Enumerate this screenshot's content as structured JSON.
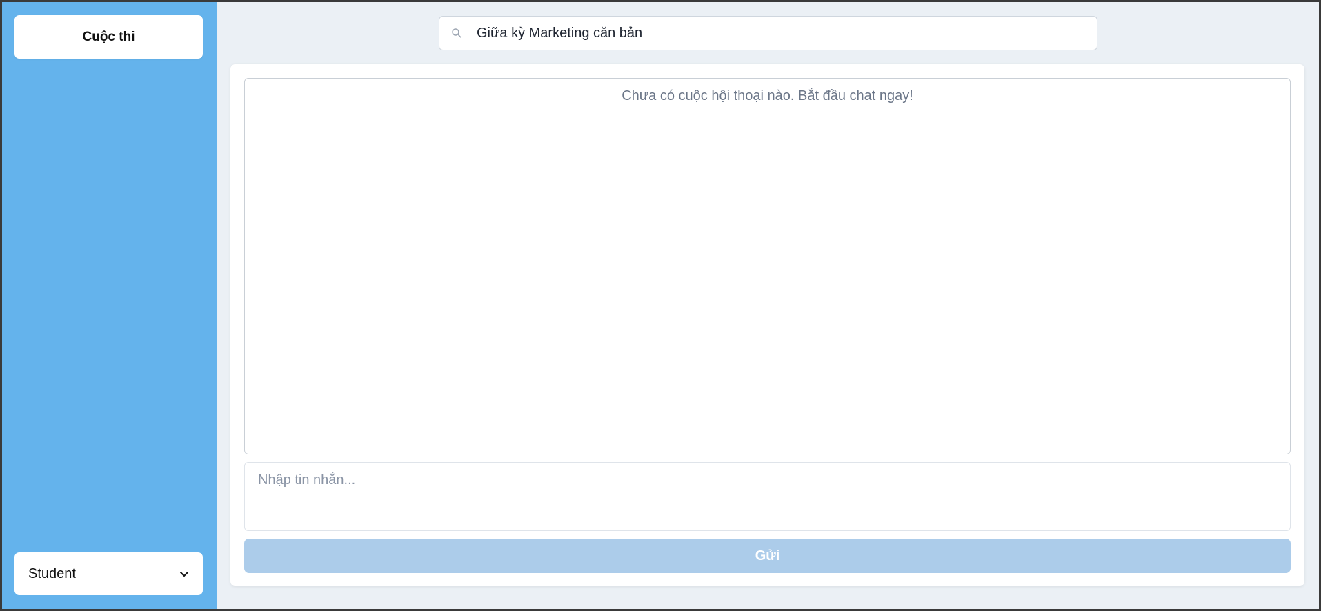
{
  "sidebar": {
    "contest_button_label": "Cuộc thi",
    "role_select": {
      "selected": "Student",
      "icon": "chevron-down-icon"
    }
  },
  "search": {
    "value": "Giữa kỳ Marketing căn bản",
    "icon": "search-icon"
  },
  "chat": {
    "empty_message": "Chưa có cuộc hội thoại nào. Bắt đầu chat ngay!",
    "input_placeholder": "Nhập tin nhắn...",
    "send_label": "Gửi"
  },
  "colors": {
    "sidebar_bg": "#64b3ec",
    "page_bg": "#ebf0f5",
    "send_button_disabled": "#acccea"
  }
}
